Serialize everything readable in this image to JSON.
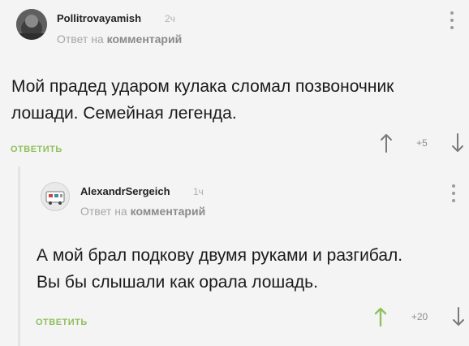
{
  "comments": [
    {
      "author": "Pollitrovayamish",
      "time": "2ч",
      "reply_prefix": "Ответ на",
      "reply_target": "комментарий",
      "text_lines": [
        "Мой прадед ударом кулака сломал позвоночник",
        "лошади. Семейная легенда."
      ],
      "reply_label": "ОТВЕТИТЬ",
      "score": "+5",
      "upvote_color": "#7a7a7a"
    },
    {
      "author": "AlexandrSergeich",
      "time": "1ч",
      "reply_prefix": "Ответ на",
      "reply_target": "комментарий",
      "text_lines": [
        "А мой брал подкову двумя руками и разгибал.",
        "Вы бы слышали как орала лошадь."
      ],
      "reply_label": "ОТВЕТИТЬ",
      "score": "+20",
      "upvote_color": "#8fc15e"
    }
  ],
  "colors": {
    "accent": "#8fbf5a",
    "background": "#f4f4f4",
    "muted": "#a6a6a6"
  },
  "icons": {
    "upvote": "arrow-up-icon",
    "downvote": "arrow-down-icon",
    "menu": "more-vertical-icon",
    "avatar": "avatar"
  }
}
